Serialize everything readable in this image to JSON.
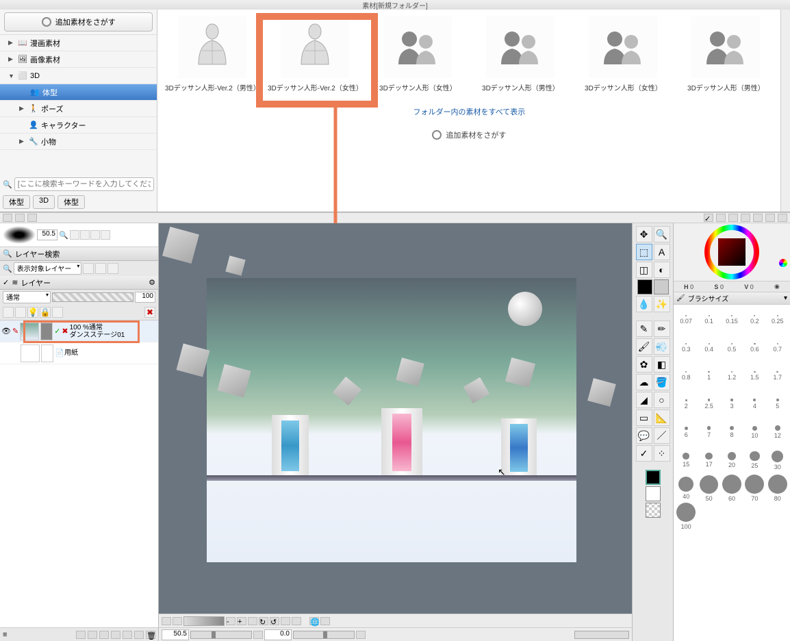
{
  "titlebar": "素材[新規フォルダー]",
  "sidebar": {
    "search_button": "追加素材をさがす",
    "tree": [
      {
        "label": "漫画素材",
        "arrow": "▶",
        "icon": "📖"
      },
      {
        "label": "画像素材",
        "arrow": "▶",
        "icon": "🖼"
      },
      {
        "label": "3D",
        "arrow": "▼",
        "icon": "⬜",
        "expanded": true
      },
      {
        "label": "体型",
        "arrow": "",
        "icon": "👥",
        "indent": 2,
        "selected": true
      },
      {
        "label": "ポーズ",
        "arrow": "▶",
        "icon": "🚶",
        "indent": 1
      },
      {
        "label": "キャラクター",
        "arrow": "",
        "icon": "👤",
        "indent": 1
      },
      {
        "label": "小物",
        "arrow": "▶",
        "icon": "🔧",
        "indent": 1
      }
    ],
    "search_placeholder": "[ここに検索キーワードを入力してください]",
    "tags": [
      "体型",
      "3D",
      "体型"
    ]
  },
  "materials": {
    "items": [
      {
        "label": "3Dデッサン人形-Ver.2（男性）",
        "type": "torso"
      },
      {
        "label": "3Dデッサン人形-Ver.2（女性）",
        "type": "torso",
        "highlighted": true
      },
      {
        "label": "3Dデッサン人形（女性）",
        "type": "silhouette"
      },
      {
        "label": "3Dデッサン人形（男性）",
        "type": "silhouette"
      },
      {
        "label": "3Dデッサン人形（女性）",
        "type": "silhouette"
      },
      {
        "label": "3Dデッサン人形（男性）",
        "type": "silhouette"
      }
    ],
    "folder_link": "フォルダー内の素材をすべて表示",
    "search_again": "追加素材をさがす"
  },
  "layers": {
    "search_label": "レイヤー検索",
    "target_label": "表示対象レイヤー",
    "panel_label": "レイヤー",
    "blend_mode": "通常",
    "opacity": "100",
    "items": [
      {
        "name": "100 %通常",
        "sub": "ダンスステージ01",
        "highlighted": true
      },
      {
        "name": "用紙",
        "sub": ""
      }
    ]
  },
  "canvas": {
    "zoom_display": "50.5",
    "zoom_bottom": "50.5",
    "angle": "0.0"
  },
  "color": {
    "h_label": "H",
    "h_val": "0",
    "s_label": "S",
    "s_val": "0",
    "v_label": "V",
    "v_val": "0"
  },
  "brush_panel": {
    "label": "ブラシサイズ",
    "sizes": [
      "0.07",
      "0.1",
      "0.15",
      "0.2",
      "0.25",
      "0.3",
      "0.4",
      "0.5",
      "0.6",
      "0.7",
      "0.8",
      "1",
      "1.2",
      "1.5",
      "1.7",
      "2",
      "2.5",
      "3",
      "4",
      "5",
      "6",
      "7",
      "8",
      "10",
      "12",
      "15",
      "17",
      "20",
      "25",
      "30",
      "40",
      "50",
      "60",
      "70",
      "80",
      "100"
    ]
  }
}
